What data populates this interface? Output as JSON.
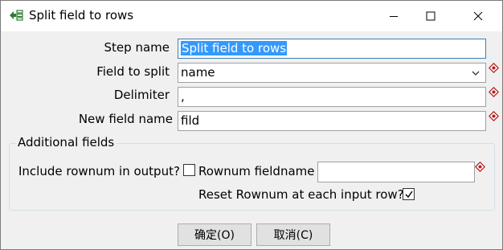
{
  "window": {
    "title": "Split field to rows"
  },
  "form": {
    "step_name_label": "Step name",
    "step_name_value": "Split field to rows",
    "field_to_split_label": "Field to split",
    "field_to_split_value": "name",
    "delimiter_label": "Delimiter",
    "delimiter_value": ",",
    "new_field_name_label": "New field name",
    "new_field_name_value": "fild"
  },
  "additional_fields": {
    "title": "Additional fields",
    "include_rownum_label": "Include rownum in output?",
    "include_rownum_checked": false,
    "rownum_fieldname_label": "Rownum fieldname",
    "rownum_fieldname_value": "",
    "reset_rownum_label": "Reset Rownum at each input row?",
    "reset_rownum_checked": true
  },
  "buttons": {
    "ok_label": "确定(O)",
    "cancel_label": "取消(C)"
  },
  "colors": {
    "selection": "#3399ff",
    "variable_icon": "#b71c1c"
  }
}
